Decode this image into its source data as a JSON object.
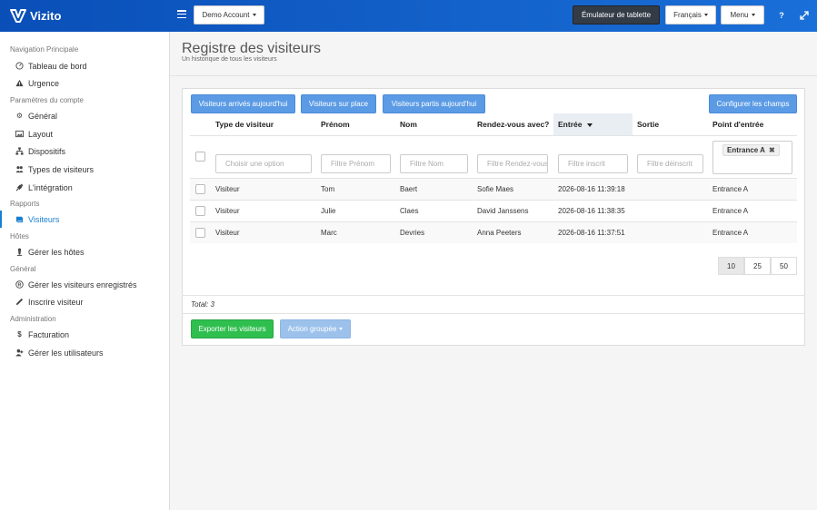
{
  "app": {
    "name": "Vizito"
  },
  "topbar": {
    "account_label": "Demo Account",
    "tablet_label": "Émulateur de tablette",
    "language_label": "Français",
    "menu_label": "Menu",
    "help_label": "?"
  },
  "sidebar": {
    "sections": [
      {
        "title": "Navigation Principale"
      },
      {
        "title": "Paramètres du compte"
      },
      {
        "title": "Rapports"
      },
      {
        "title": "Hôtes"
      },
      {
        "title": "Général"
      },
      {
        "title": "Administration"
      }
    ],
    "items": [
      {
        "label": "Tableau de bord",
        "icon": "dashboard-icon"
      },
      {
        "label": "Urgence",
        "icon": "warning-icon"
      },
      {
        "label": "Général",
        "icon": "gear-icon"
      },
      {
        "label": "Layout",
        "icon": "image-icon"
      },
      {
        "label": "Dispositifs",
        "icon": "sitemap-icon"
      },
      {
        "label": "Types de visiteurs",
        "icon": "users-icon"
      },
      {
        "label": "L'intégration",
        "icon": "plug-icon"
      },
      {
        "label": "Visiteurs",
        "icon": "book-icon",
        "active": true
      },
      {
        "label": "Gérer les hôtes",
        "icon": "host-icon"
      },
      {
        "label": "Gérer les visiteurs enregistrés",
        "icon": "registered-icon"
      },
      {
        "label": "Inscrire visiteur",
        "icon": "pencil-icon"
      },
      {
        "label": "Facturation",
        "icon": "dollar-icon"
      },
      {
        "label": "Gérer les utilisateurs",
        "icon": "user-plus-icon"
      }
    ]
  },
  "page": {
    "title": "Registre des visiteurs",
    "subtitle": "Un historique de tous les visiteurs"
  },
  "toolbar": {
    "arrived_today": "Visiteurs arrivés aujourd'hui",
    "on_site": "Visiteurs sur place",
    "left_today": "Visiteurs partis aujourd'hui",
    "configure_fields": "Configurer les champs"
  },
  "table": {
    "headers": [
      "Type de visiteur",
      "Prénom",
      "Nom",
      "Rendez-vous avec?",
      "Entrée",
      "Sortie",
      "Point d'entrée"
    ],
    "filters": {
      "type": "Choisir une option",
      "firstname": "Filtre Prénom",
      "lastname": "Filtre Nom",
      "host": "Filtre Rendez-vous",
      "entry": "Filtre inscrit",
      "exit": "Filtre déinscrit",
      "entry_point_tag": "Entrance A",
      "remove_tag": "✖"
    },
    "rows": [
      {
        "type": "Visiteur",
        "firstname": "Tom",
        "lastname": "Baert",
        "host": "Sofie Maes",
        "entry": "2026-08-16 11:39:18",
        "exit": "",
        "point": "Entrance A"
      },
      {
        "type": "Visiteur",
        "firstname": "Julie",
        "lastname": "Claes",
        "host": "David Janssens",
        "entry": "2026-08-16 11:38:35",
        "exit": "",
        "point": "Entrance A"
      },
      {
        "type": "Visiteur",
        "firstname": "Marc",
        "lastname": "Devries",
        "host": "Anna Peeters",
        "entry": "2026-08-16 11:37:51",
        "exit": "",
        "point": "Entrance A"
      }
    ]
  },
  "pagination": {
    "sizes": [
      "10",
      "25",
      "50"
    ],
    "selected": "10"
  },
  "footer": {
    "total": "Total: 3",
    "export_label": "Exporter les visiteurs",
    "bulk_label": "Action groupée"
  }
}
